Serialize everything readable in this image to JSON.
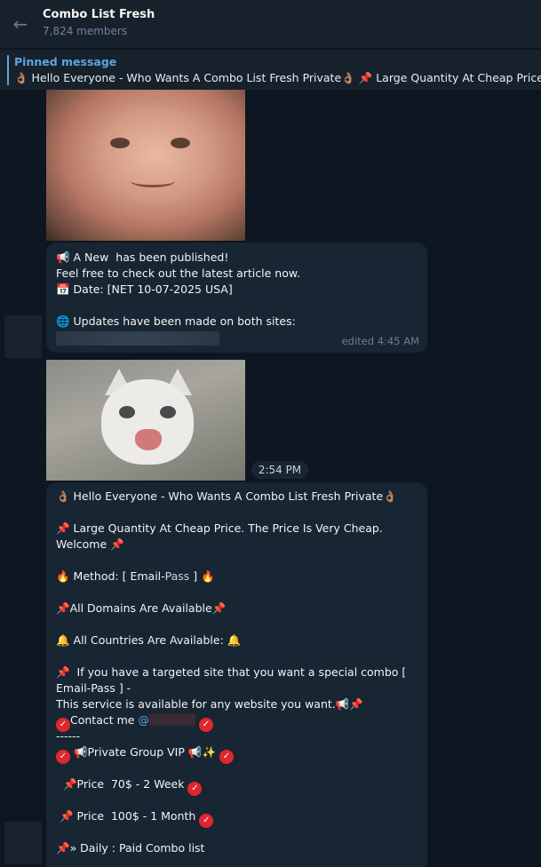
{
  "header": {
    "back_icon": "arrow-left-icon",
    "title": "Combo List Fresh",
    "members": "7,824 members"
  },
  "pinned": {
    "label": "Pinned message",
    "text": "👌🏽 Hello Everyone - Who Wants A Combo List Fresh Private👌🏽 📌 Large Quantity At Cheap Price."
  },
  "message1": {
    "lines": [
      "📢 A New  has been published!",
      "Feel free to check out the latest article now.",
      "📅 Date: [NET 10-07-2025 USA]",
      "",
      "🌐 Updates have been made on both sites:"
    ],
    "meta": "edited 4:45 AM"
  },
  "message2": {
    "time": "2:54 PM"
  },
  "message3": {
    "l1": "👌🏽 Hello Everyone - Who Wants A Combo List Fresh Private👌🏽",
    "l2": "📌 Large Quantity At Cheap Price. The Price Is Very Cheap.",
    "l3": "Welcome 📌",
    "l4a": "🔥 Method: [ Email-",
    "l4b": "Pass",
    "l4c": " ] 🔥",
    "l5": "📌All Domains Are Available📌",
    "l6": "🔔 All Countries Are Available: 🔔",
    "l7": "📌  If you have a targeted site that you want a special combo [",
    "l8": "Email-Pass ] -",
    "l9": "This service is available for any website you want.📢📌",
    "l10a": "Contact me ",
    "l10b": "@",
    "l11": "------",
    "l12": "📢Private Group VIP 📢✨",
    "l13": "  📌Price  70$ - 2 Week",
    "l14": " 📌 Price  100$ - 1 Month",
    "l15": "📌» Daily : Paid Combo list"
  }
}
